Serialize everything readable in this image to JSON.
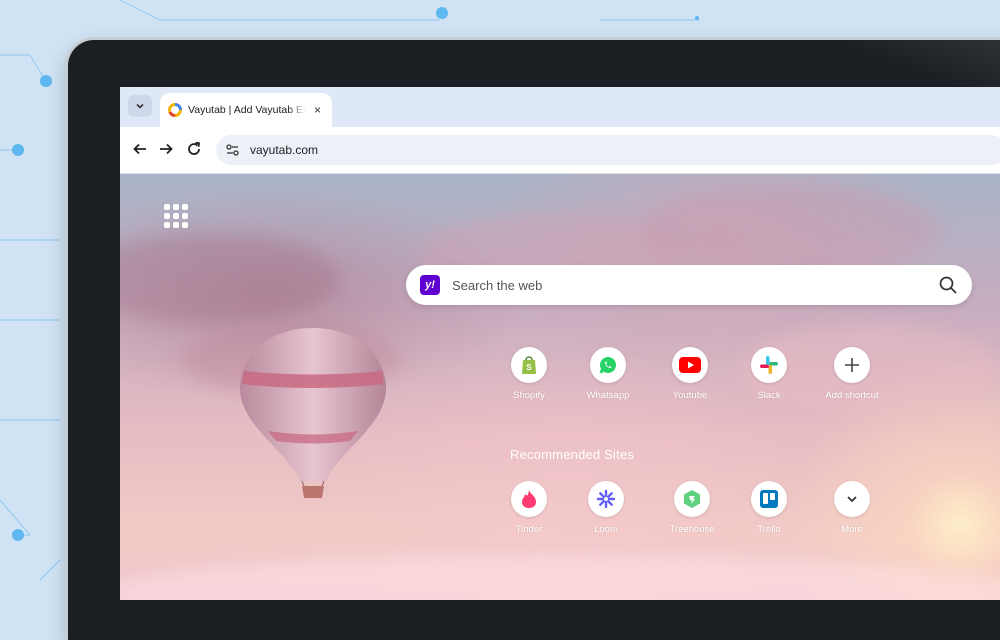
{
  "browser": {
    "tab": {
      "title": "Vayutab | Add Vayutab Extension",
      "close_glyph": "×"
    },
    "toolbar": {
      "url": "vayutab.com"
    }
  },
  "page": {
    "search": {
      "placeholder": "Search the web",
      "logo_text": "y!"
    },
    "shortcuts": [
      {
        "label": "Shopify",
        "icon": "shopify-icon"
      },
      {
        "label": "Whatsapp",
        "icon": "whatsapp-icon"
      },
      {
        "label": "Youtube",
        "icon": "youtube-icon"
      },
      {
        "label": "Slack",
        "icon": "slack-icon"
      },
      {
        "label": "Add shortcut",
        "icon": "plus-icon"
      }
    ],
    "recommended": {
      "heading": "Recommended Sites",
      "items": [
        {
          "label": "Tinder",
          "icon": "tinder-icon"
        },
        {
          "label": "Loom",
          "icon": "loom-icon"
        },
        {
          "label": "Treehouse",
          "icon": "treehouse-icon"
        },
        {
          "label": "Trello",
          "icon": "trello-icon"
        },
        {
          "label": "More",
          "icon": "chevron-down-icon"
        }
      ]
    }
  },
  "colors": {
    "yahoo": "#5f01d1",
    "shopify": "#95bf47",
    "whatsapp": "#25d366",
    "youtube": "#ff0000",
    "tinder": "#fe3c72",
    "loom": "#625df5",
    "treehouse": "#5fcf80",
    "trello": "#0079bf"
  }
}
